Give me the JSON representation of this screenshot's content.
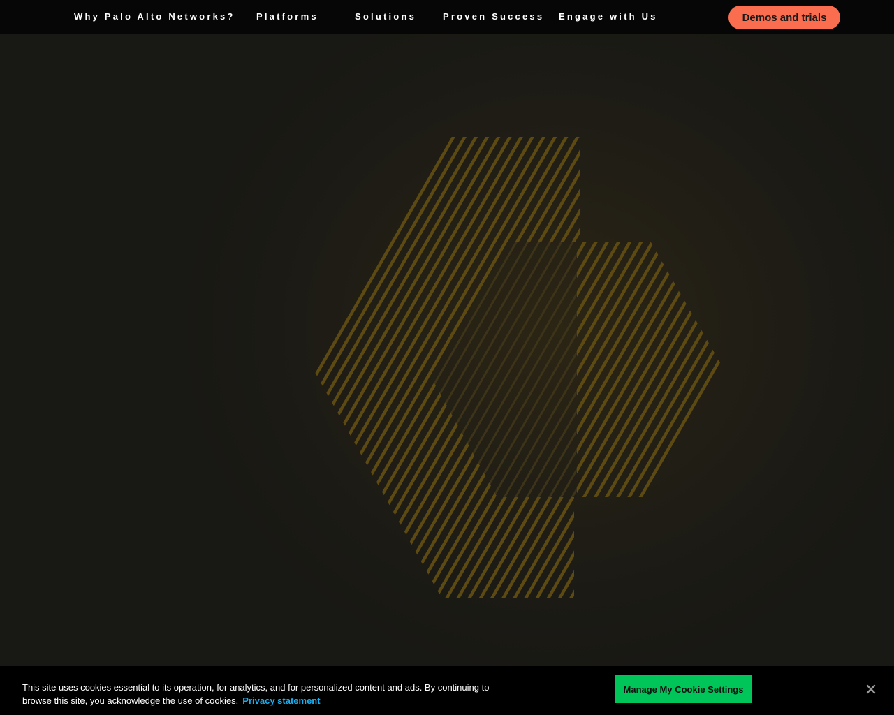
{
  "nav": {
    "items": [
      {
        "label": "Why Palo Alto Networks?"
      },
      {
        "label": "Platforms"
      },
      {
        "label": "Solutions"
      },
      {
        "label": "Proven Success"
      },
      {
        "label": "Engage with Us"
      }
    ],
    "cta_label": "Demos and trials"
  },
  "hero": {
    "graphic_icon": "striped-hexagon-logo-icon"
  },
  "cookie_banner": {
    "text": "This site uses cookies essential to its operation, for analytics, and for personalized content and ads. By continuing to browse this site, you acknowledge the use of cookies.",
    "privacy_link_label": "Privacy statement",
    "settings_button_label": "Manage My Cookie Settings",
    "close_icon": "close-icon"
  },
  "colors": {
    "nav_background": "#060606",
    "cta_background": "#fa6e4f",
    "page_background": "#1b1a15",
    "hex_stripe": "#5c4a12",
    "cookie_background": "#000000",
    "cookie_button": "#00c65a",
    "link": "#1ab0f0"
  }
}
